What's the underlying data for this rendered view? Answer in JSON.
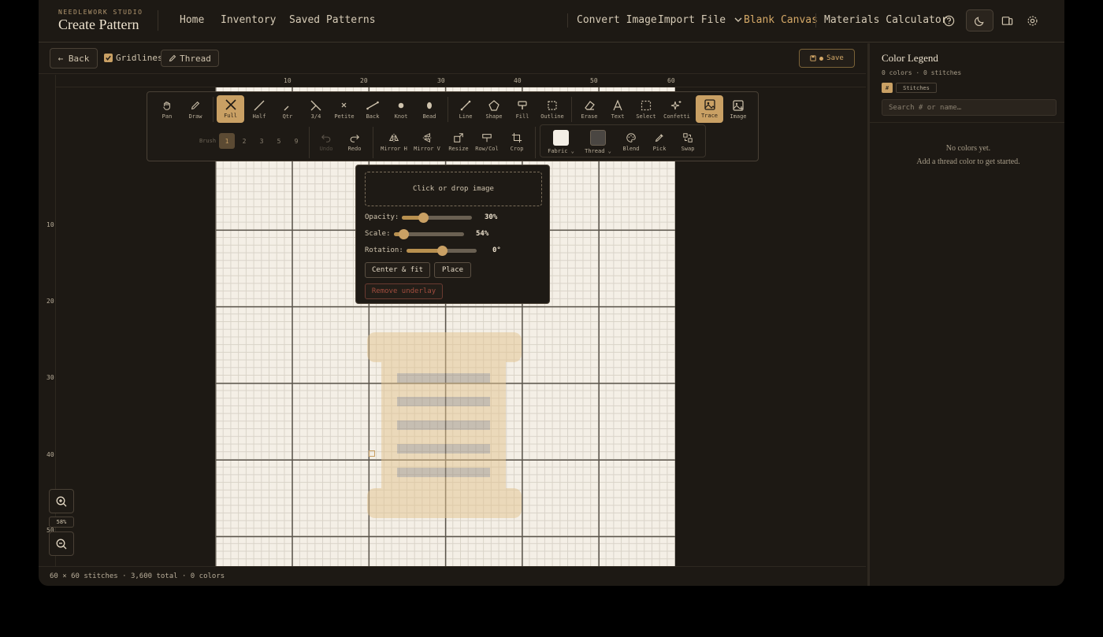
{
  "header": {
    "brand_sub": "NEEDLEWORK STUDIO",
    "title": "Create Pattern",
    "nav": {
      "home": "Home",
      "inventory": "Inventory",
      "saved": "Saved Patterns"
    },
    "right_nav": {
      "convert": "Convert Image",
      "import": "Import File",
      "blank": "Blank Canvas",
      "materials": "Materials Calculator"
    }
  },
  "subbar": {
    "back": "← Back",
    "gridlines": "Gridlines",
    "thread": "Thread",
    "save": "Save"
  },
  "rulers": {
    "top": [
      "10",
      "20",
      "30",
      "40",
      "50",
      "60"
    ],
    "left": [
      "10",
      "20",
      "30",
      "40",
      "50"
    ]
  },
  "toolbar": {
    "row1": [
      "Pan",
      "Draw",
      "Full",
      "Half",
      "Qtr",
      "3/4",
      "Petite",
      "Back",
      "Knot",
      "Bead",
      "Line",
      "Shape",
      "Fill",
      "Outline",
      "Erase",
      "Text",
      "Select",
      "Confetti",
      "Trace",
      "Image"
    ],
    "brush_label": "Brush",
    "brush_sizes": [
      "1",
      "2",
      "3",
      "5",
      "9"
    ],
    "row2": [
      "Undo",
      "Redo",
      "Mirror H",
      "Mirror V",
      "Resize",
      "Row/Col",
      "Crop"
    ],
    "fabric": "Fabric",
    "thread": "Thread",
    "row2b": [
      "Blend",
      "Pick",
      "Swap"
    ],
    "fabric_color": "#f4efe6",
    "thread_color": "#4a4642"
  },
  "underlay": {
    "drop_text": "Click or drop image",
    "opacity_label": "Opacity:",
    "opacity_value": "30%",
    "opacity": 0.3,
    "scale_label": "Scale:",
    "scale_value": "54%",
    "scale": 0.13,
    "rotation_label": "Rotation:",
    "rotation_value": "0°",
    "rotation": 0.5,
    "center_fit": "Center & fit",
    "place": "Place",
    "remove": "Remove underlay"
  },
  "zoom": {
    "level": "58%"
  },
  "status": "60 × 60 stitches · 3,600 total · 0 colors",
  "legend": {
    "title": "Color Legend",
    "sub": "0 colors · 0 stitches",
    "chip_hash": "#",
    "chip_stitches": "Stitches",
    "search_placeholder": "Search  # or name…",
    "empty_1": "No colors yet.",
    "empty_2": "Add a thread color to get started."
  },
  "colors": {
    "accent": "#d4a867",
    "bg": "#1d1914",
    "canvas": "#f4efe6"
  }
}
